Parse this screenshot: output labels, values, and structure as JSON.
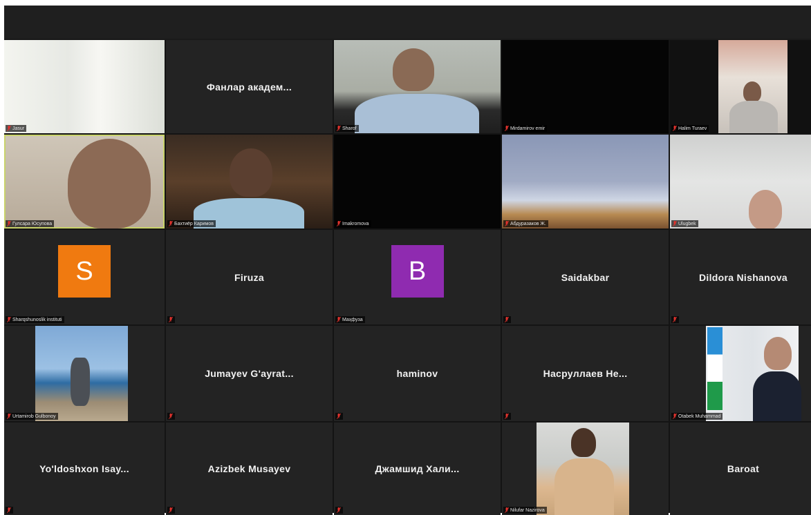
{
  "tiles": [
    {
      "name": "Jasur",
      "kind": "video",
      "bg": "wall",
      "label": "Jasur"
    },
    {
      "name": "Фанлар академ...",
      "kind": "namecard"
    },
    {
      "name": "Sharof",
      "kind": "video",
      "bg": "office",
      "label": "Sharof"
    },
    {
      "name": "Mirdamirov emir",
      "kind": "video",
      "bg": "black",
      "label": "Mirdamirov emir"
    },
    {
      "name": "Halim Turaev",
      "kind": "video",
      "bg": "room",
      "label": "Halim Turaev"
    },
    {
      "name": "Гулсара Юсупова",
      "kind": "video",
      "bg": "lady",
      "label": "Гулсара Юсупова",
      "active": true
    },
    {
      "name": "Бахтиёр Каримов",
      "kind": "video",
      "bg": "books",
      "label": "Бахтиёр Каримов"
    },
    {
      "name": "Imakromova",
      "kind": "video",
      "bg": "black",
      "label": "Imakromova"
    },
    {
      "name": "Абдуразаков Ж.",
      "kind": "video",
      "bg": "blind",
      "label": "Абдуразаков Ж."
    },
    {
      "name": "Ulugbek",
      "kind": "video",
      "bg": "ceiling",
      "label": "Ulugbek"
    },
    {
      "name": "Sharqshunoslik instituti",
      "kind": "avatar",
      "letter": "S",
      "color": "#f07a10",
      "label": "Sharqshunoslik instituti"
    },
    {
      "name": "Firuza",
      "kind": "namecard",
      "label": ""
    },
    {
      "name": "Маҳфуза",
      "kind": "avatar",
      "letter": "B",
      "color": "#8f2bb0",
      "label": "Маҳфуза"
    },
    {
      "name": "Saidakbar",
      "kind": "namecard",
      "label": ""
    },
    {
      "name": "Dildora Nishanova",
      "kind": "namecard",
      "label": ""
    },
    {
      "name": "Urtamirob Gulbonoy",
      "kind": "video",
      "bg": "beach",
      "label": "Urtamirob Gulbonoy"
    },
    {
      "name": "Jumayev G'ayrat...",
      "kind": "namecard",
      "label": ""
    },
    {
      "name": "haminov",
      "kind": "namecard",
      "label": ""
    },
    {
      "name": "Насруллаев Не...",
      "kind": "namecard",
      "label": ""
    },
    {
      "name": "Otabek Muhammad",
      "kind": "video",
      "bg": "flag",
      "label": "Otabek Muhammad"
    },
    {
      "name": "Yo'ldoshxon Isay...",
      "kind": "namecard",
      "label": ""
    },
    {
      "name": "Azizbek Musayev",
      "kind": "namecard",
      "label": ""
    },
    {
      "name": "Джамшид Хали...",
      "kind": "namecard",
      "label": ""
    },
    {
      "name": "Nilufar Nazirova",
      "kind": "video",
      "bg": "nilufar",
      "label": "Nilufar Nazirova"
    },
    {
      "name": "Baroat",
      "kind": "namecard",
      "label": ""
    }
  ],
  "colors": {
    "active_outline": "#c9d36a",
    "muted_mic": "#e0322d"
  }
}
